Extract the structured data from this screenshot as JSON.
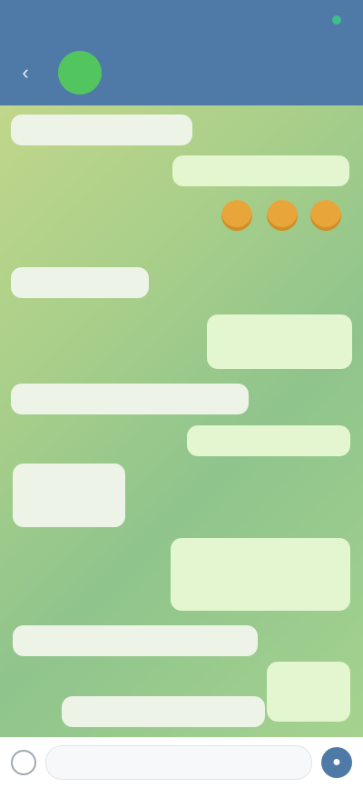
{
  "status": {
    "time": "",
    "battery": ""
  },
  "header": {
    "title": "",
    "subtitle": "",
    "avatar_letter": ""
  },
  "messages": [
    {
      "dir": "in",
      "text": "",
      "time": ""
    },
    {
      "dir": "out",
      "text": "",
      "time": ""
    },
    {
      "dir": "out",
      "text": "",
      "time": ""
    },
    {
      "dir": "in",
      "text": "",
      "time": ""
    },
    {
      "dir": "out",
      "text": "",
      "time": ""
    },
    {
      "dir": "in",
      "text": "",
      "time": ""
    },
    {
      "dir": "out",
      "text": "",
      "time": ""
    },
    {
      "dir": "in",
      "text": "",
      "time": ""
    },
    {
      "dir": "out",
      "text": "",
      "time": ""
    },
    {
      "dir": "in",
      "text": "",
      "time": ""
    },
    {
      "dir": "out",
      "text": "",
      "time": ""
    }
  ],
  "composer": {
    "placeholder": ""
  },
  "colors": {
    "header": "#4f7aa8",
    "incoming": "#eef3e8",
    "outgoing": "#e3f6cf",
    "avatar": "#52c55f"
  }
}
